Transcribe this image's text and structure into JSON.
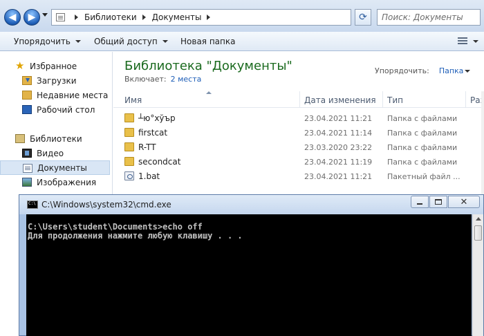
{
  "address": {
    "crumbs": [
      "Библиотеки",
      "Документы"
    ],
    "search_placeholder": "Поиск: Документы"
  },
  "toolbar": {
    "organize": "Упорядочить",
    "share": "Общий доступ",
    "new_folder": "Новая папка"
  },
  "sidebar": {
    "favorites": "Избранное",
    "fav_items": [
      "Загрузки",
      "Недавние места",
      "Рабочий стол"
    ],
    "libraries": "Библиотеки",
    "lib_items": [
      "Видео",
      "Документы",
      "Изображения"
    ]
  },
  "content": {
    "title": "Библиотека \"Документы\"",
    "includes_label": "Включает:",
    "includes_link": "2 места",
    "arrange_label": "Упорядочить:",
    "arrange_value": "Папка",
    "columns": [
      "Имя",
      "Дата изменения",
      "Тип",
      "Раз"
    ],
    "files": [
      {
        "name": "┴ю°хўър",
        "date": "23.04.2021 11:21",
        "type": "Папка с файлами"
      },
      {
        "name": "firstcat",
        "date": "23.04.2021 11:14",
        "type": "Папка с файлами"
      },
      {
        "name": "R-TT",
        "date": "23.03.2020 23:22",
        "type": "Папка с файлами"
      },
      {
        "name": "secondcat",
        "date": "23.04.2021 11:19",
        "type": "Папка с файлами"
      },
      {
        "name": "1.bat",
        "date": "23.04.2021 11:21",
        "type": "Пакетный файл ..."
      }
    ]
  },
  "cmd": {
    "title": "C:\\Windows\\system32\\cmd.exe",
    "lines": [
      "C:\\Users\\student\\Documents>echo off",
      "Для продолжения нажмите любую клавишу . . ."
    ],
    "close_glyph": "✕"
  }
}
